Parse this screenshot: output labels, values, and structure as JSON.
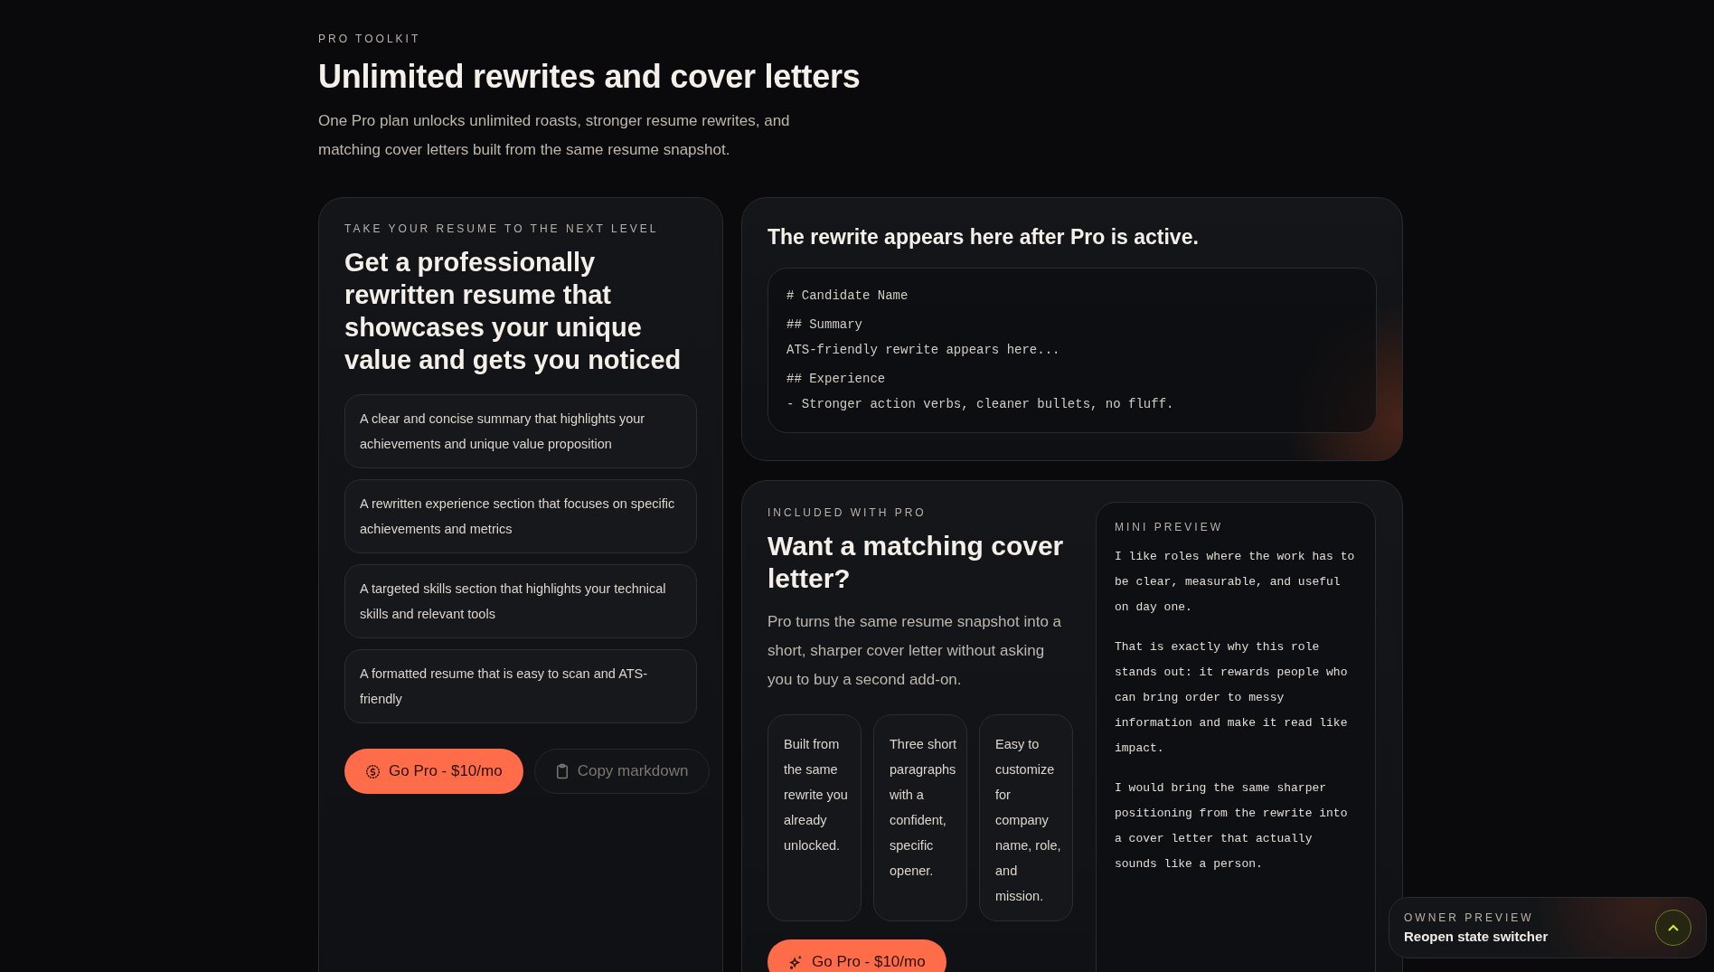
{
  "header": {
    "eyebrow": "PRO TOOLKIT",
    "title": "Unlimited rewrites and cover letters",
    "description": "One Pro plan unlocks unlimited roasts, stronger resume rewrites, and matching cover letters built from the same resume snapshot."
  },
  "rewrite_card": {
    "eyebrow": "TAKE YOUR RESUME TO THE NEXT LEVEL",
    "title": "Get a professionally rewritten resume that showcases your unique value and gets you noticed",
    "features": [
      "A clear and concise summary that highlights your achievements and unique value proposition",
      "A rewritten experience section that focuses on specific achievements and metrics",
      "A targeted skills section that highlights your technical skills and relevant tools",
      "A formatted resume that is easy to scan and ATS-friendly"
    ],
    "buttons": [
      {
        "label": "Go Pro - $10/mo",
        "kind": "upgrade",
        "disabled": false
      },
      {
        "label": "Copy markdown",
        "kind": "copy",
        "disabled": true
      }
    ]
  },
  "output_card": {
    "title": "The rewrite appears here after Pro is active.",
    "lines": [
      {
        "text": "# Candidate Name",
        "kind": "heading"
      },
      {
        "text": "## Summary",
        "kind": "heading"
      },
      {
        "text": "ATS-friendly rewrite appears here...",
        "kind": "text"
      },
      {
        "text": "## Experience",
        "kind": "heading"
      },
      {
        "text": "- Stronger action verbs, cleaner bullets, no fluff.",
        "kind": "text"
      }
    ]
  },
  "cover_letter_card": {
    "eyebrow": "INCLUDED WITH PRO",
    "title": "Want a matching cover letter?",
    "description": "Pro turns the same resume snapshot into a short, sharper cover letter without asking you to buy a second add-on.",
    "points": [
      "Built from the same rewrite you already unlocked.",
      "Three short paragraphs with a confident, specific opener.",
      "Easy to customize for company name, role, and mission."
    ],
    "button": {
      "label": "Go Pro - $10/mo"
    },
    "mini_preview": {
      "title": "MINI PREVIEW",
      "paragraphs": [
        "I like roles where the work has to be clear, measurable, and useful on day one.",
        "That is exactly why this role stands out: it rewards people who can bring order to messy information and make it read like impact.",
        "I would bring the same sharper positioning from the rewrite into a cover letter that actually sounds like a person."
      ]
    }
  },
  "owner_preview": {
    "eyebrow": "OWNER PREVIEW",
    "title": "Reopen state switcher"
  }
}
